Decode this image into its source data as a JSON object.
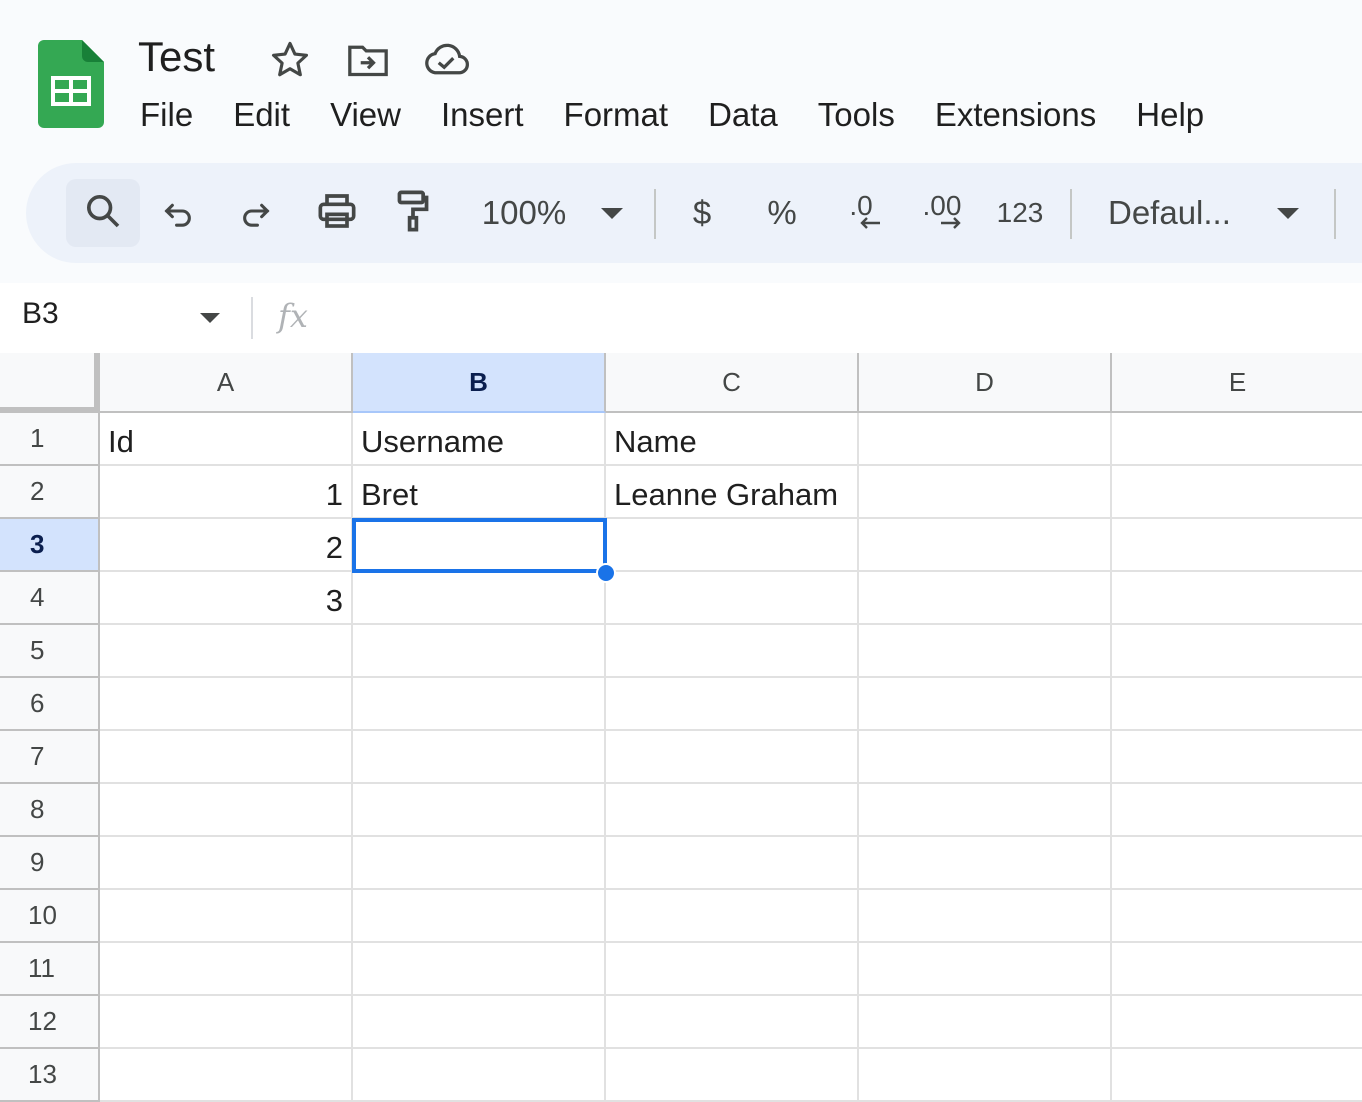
{
  "app": {
    "title": "Test"
  },
  "menu": {
    "items": [
      "File",
      "Edit",
      "View",
      "Insert",
      "Format",
      "Data",
      "Tools",
      "Extensions",
      "Help"
    ]
  },
  "toolbar": {
    "zoom": "100%",
    "currency": "$",
    "percent": "%",
    "decrease_decimal": ".0",
    "increase_decimal": ".00",
    "number_format": "123",
    "font": "Defaul..."
  },
  "formula_bar": {
    "cell_ref": "B3",
    "fx_label": "fx",
    "value": ""
  },
  "sheet": {
    "columns": [
      "A",
      "B",
      "C",
      "D",
      "E"
    ],
    "selected_column": "B",
    "rows": [
      "1",
      "2",
      "3",
      "4",
      "5",
      "6",
      "7",
      "8",
      "9",
      "10",
      "11",
      "12",
      "13"
    ],
    "selected_row": "3",
    "cells": {
      "A1": "Id",
      "B1": "Username",
      "C1": "Name",
      "A2": "1",
      "B2": "Bret",
      "C2": "Leanne Graham",
      "A3": "2",
      "A4": "3"
    }
  },
  "colors": {
    "accent": "#1a73e8",
    "selected_header": "#d3e3fd",
    "logo_green": "#34a853"
  }
}
